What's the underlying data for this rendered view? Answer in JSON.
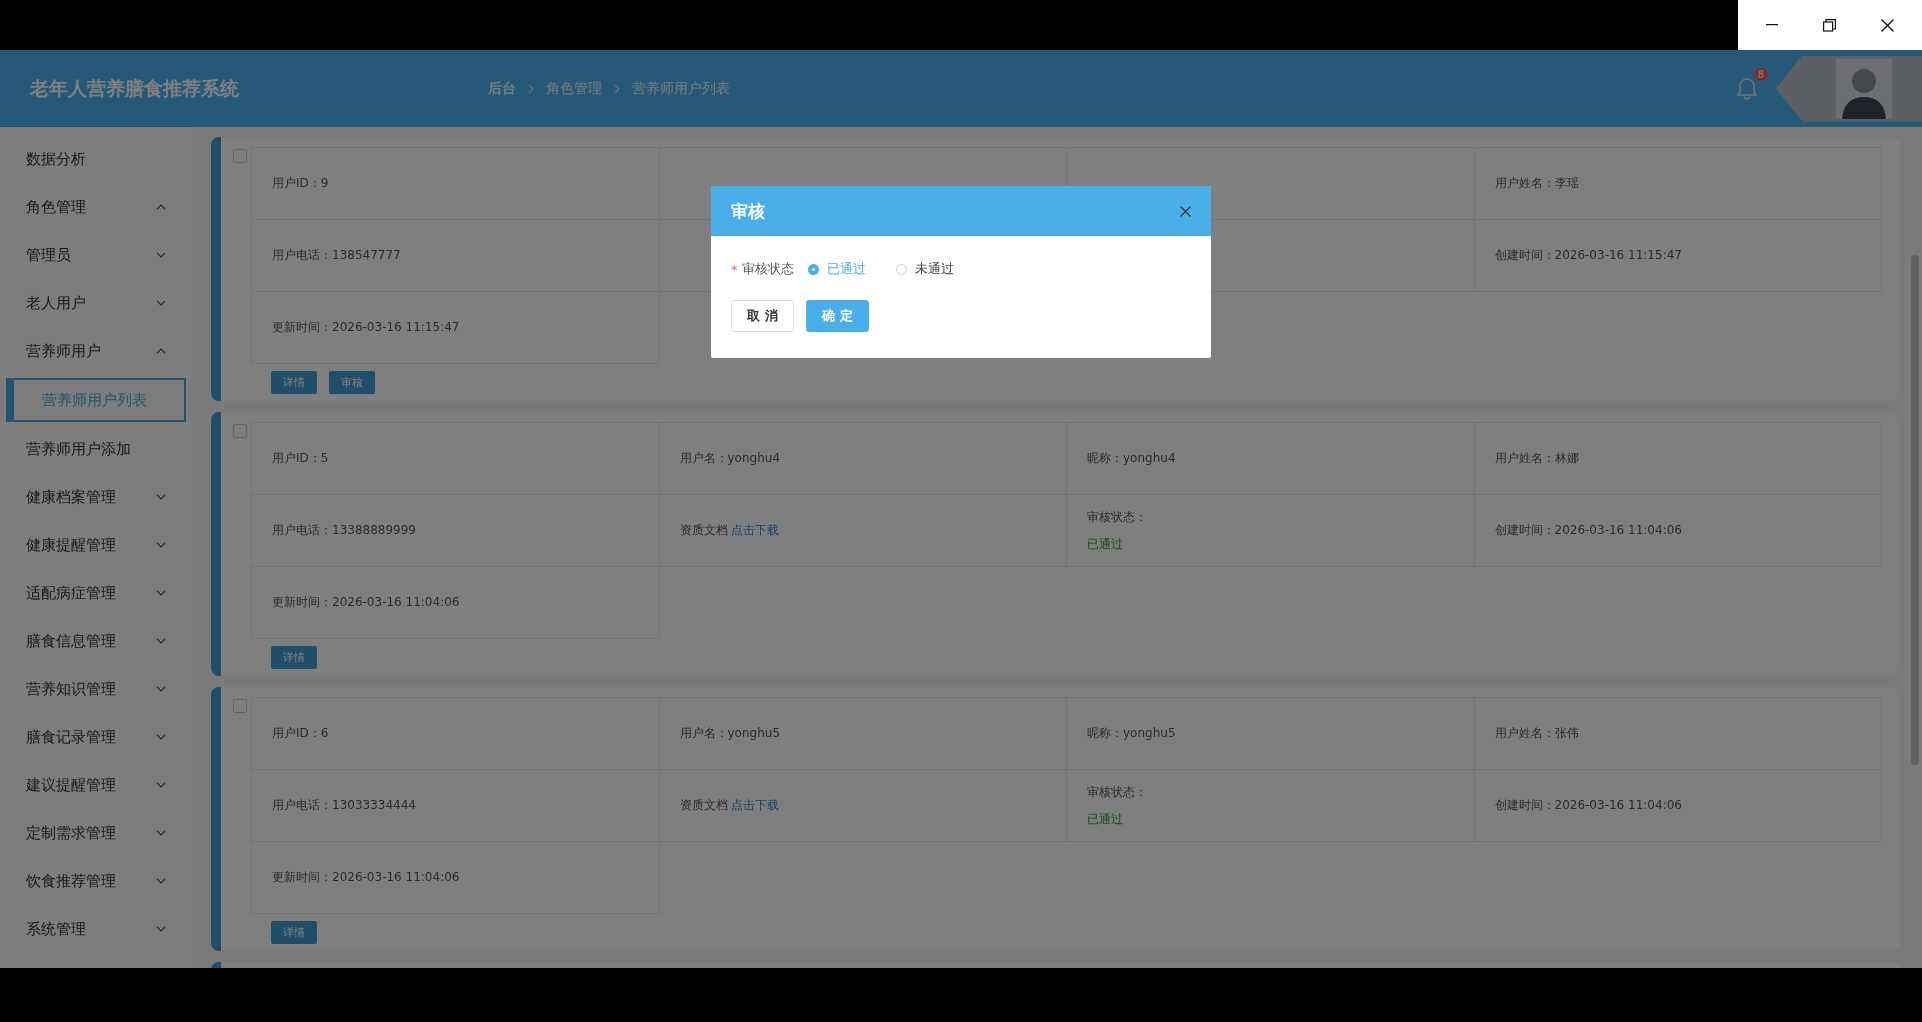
{
  "app": {
    "title": "老年人营养膳食推荐系统"
  },
  "breadcrumb": [
    "后台",
    "角色管理",
    "营养师用户列表"
  ],
  "notifications": {
    "badge": "8"
  },
  "sidebar": {
    "items": [
      {
        "label": "数据分析",
        "selected": false
      },
      {
        "label": "角色管理",
        "expanded": true,
        "children": [
          {
            "label": "管理员",
            "expanded": false
          },
          {
            "label": "老人用户",
            "expanded": false
          },
          {
            "label": "营养师用户",
            "expanded": true,
            "children": [
              {
                "label": "营养师用户列表",
                "selected": true
              },
              {
                "label": "营养师用户添加",
                "selected": false
              }
            ]
          }
        ]
      },
      {
        "label": "健康档案管理",
        "expanded": false
      },
      {
        "label": "健康提醒管理",
        "expanded": false
      },
      {
        "label": "适配病症管理",
        "expanded": false
      },
      {
        "label": "膳食信息管理",
        "expanded": false
      },
      {
        "label": "营养知识管理",
        "expanded": false
      },
      {
        "label": "膳食记录管理",
        "expanded": false
      },
      {
        "label": "建议提醒管理",
        "expanded": false
      },
      {
        "label": "定制需求管理",
        "expanded": false
      },
      {
        "label": "饮食推荐管理",
        "expanded": false
      },
      {
        "label": "系统管理",
        "expanded": false
      }
    ]
  },
  "cards": [
    {
      "checked": false,
      "cells": [
        {
          "kind": "text",
          "text": "用户ID：9"
        },
        {
          "kind": "covered"
        },
        {
          "kind": "covered"
        },
        {
          "kind": "text",
          "text": "用户姓名：李瑶"
        },
        {
          "kind": "text",
          "text": "用户电话：138547777"
        },
        {
          "kind": "covered"
        },
        {
          "kind": "covered"
        },
        {
          "kind": "text",
          "text": "创建时间：2026-03-16 11:15:47"
        },
        {
          "kind": "text",
          "text": "更新时间：2026-03-16 11:15:47"
        }
      ],
      "buttons": [
        "详情",
        "审核"
      ]
    },
    {
      "checked": false,
      "cells": [
        {
          "kind": "text",
          "text": "用户ID：5"
        },
        {
          "kind": "text",
          "text": "用户名：yonghu4"
        },
        {
          "kind": "text",
          "text": "昵称：yonghu4"
        },
        {
          "kind": "text",
          "text": "用户姓名：林娜"
        },
        {
          "kind": "text",
          "text": "用户电话：13388889999"
        },
        {
          "kind": "doc",
          "label": "资质文档",
          "link": "点击下载"
        },
        {
          "kind": "status",
          "label": "审核状态：",
          "value": "已通过"
        },
        {
          "kind": "text",
          "text": "创建时间：2026-03-16 11:04:06"
        },
        {
          "kind": "text",
          "text": "更新时间：2026-03-16 11:04:06"
        }
      ],
      "buttons": [
        "详情"
      ]
    },
    {
      "checked": false,
      "cells": [
        {
          "kind": "text",
          "text": "用户ID：6"
        },
        {
          "kind": "text",
          "text": "用户名：yonghu5"
        },
        {
          "kind": "text",
          "text": "昵称：yonghu5"
        },
        {
          "kind": "text",
          "text": "用户姓名：张伟"
        },
        {
          "kind": "text",
          "text": "用户电话：13033334444"
        },
        {
          "kind": "doc",
          "label": "资质文档",
          "link": "点击下载"
        },
        {
          "kind": "status",
          "label": "审核状态：",
          "value": "已通过"
        },
        {
          "kind": "text",
          "text": "创建时间：2026-03-16 11:04:06"
        },
        {
          "kind": "text",
          "text": "更新时间：2026-03-16 11:04:06"
        }
      ],
      "buttons": [
        "详情"
      ]
    }
  ],
  "dialog": {
    "title": "审核",
    "field": {
      "label": "审核状态",
      "required_mark": "*"
    },
    "options": [
      {
        "label": "已通过",
        "selected": true
      },
      {
        "label": "未通过",
        "selected": false
      }
    ],
    "buttons": [
      {
        "label": "取 消",
        "kind": "default"
      },
      {
        "label": "确 定",
        "kind": "primary"
      }
    ]
  }
}
